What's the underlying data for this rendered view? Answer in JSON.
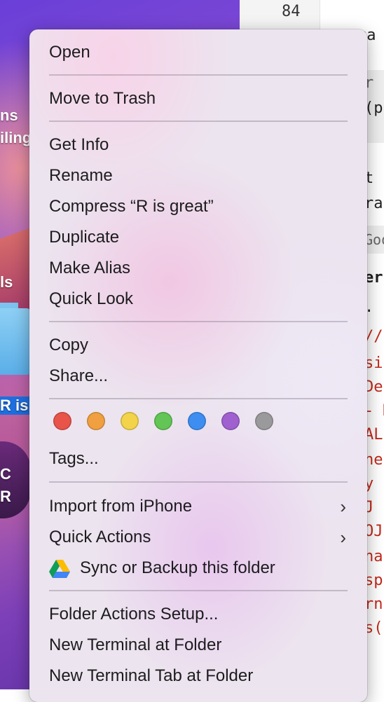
{
  "desktop": {
    "labels": [
      "ns",
      "iling",
      "ls",
      "R is",
      "C",
      "R"
    ]
  },
  "editor": {
    "line_number": "84",
    "code_lines": [
      {
        "text": "ca",
        "color": "dark"
      },
      {
        "text": "r",
        "color": "gray"
      },
      {
        "text": "(p",
        "color": "dark"
      },
      {
        "text": "t",
        "color": "dark"
      },
      {
        "text": "ra",
        "color": "dark"
      },
      {
        "text": "Goo",
        "color": "gray"
      },
      {
        "text": "ern",
        "color": "dark"
      },
      {
        "text": ".",
        "color": "dark"
      },
      {
        "text": "//",
        "color": "red"
      },
      {
        "text": "sio",
        "color": "red"
      },
      {
        "text": " De",
        "color": "red"
      },
      {
        "text": "- M",
        "color": "red"
      },
      {
        "text": "AL",
        "color": "red"
      },
      {
        "text": " ne",
        "color": "red"
      },
      {
        "text": "y E",
        "color": "red"
      },
      {
        "text": "J n",
        "color": "red"
      },
      {
        "text": "OJ",
        "color": "red"
      },
      {
        "text": "nal",
        "color": "red"
      },
      {
        "text": " sp",
        "color": "red"
      },
      {
        "text": "rn",
        "color": "red"
      },
      {
        "text": "s(",
        "color": "red"
      }
    ]
  },
  "menu": {
    "open": "Open",
    "move_to_trash": "Move to Trash",
    "get_info": "Get Info",
    "rename": "Rename",
    "compress": "Compress “R is great”",
    "duplicate": "Duplicate",
    "make_alias": "Make Alias",
    "quick_look": "Quick Look",
    "copy": "Copy",
    "share": "Share...",
    "tag_colors": [
      "#e8534a",
      "#f0a040",
      "#f3d34a",
      "#62c555",
      "#3d8ef0",
      "#a060d0",
      "#9a9a9c"
    ],
    "tags": "Tags...",
    "import_from_iphone": "Import from iPhone",
    "quick_actions": "Quick Actions",
    "sync_backup": "Sync or Backup this folder",
    "folder_actions_setup": "Folder Actions Setup...",
    "new_terminal": "New Terminal at Folder",
    "new_terminal_tab": "New Terminal Tab at Folder",
    "submenu_icon": "chevron-right-icon",
    "drive_icon": "google-drive-icon"
  }
}
